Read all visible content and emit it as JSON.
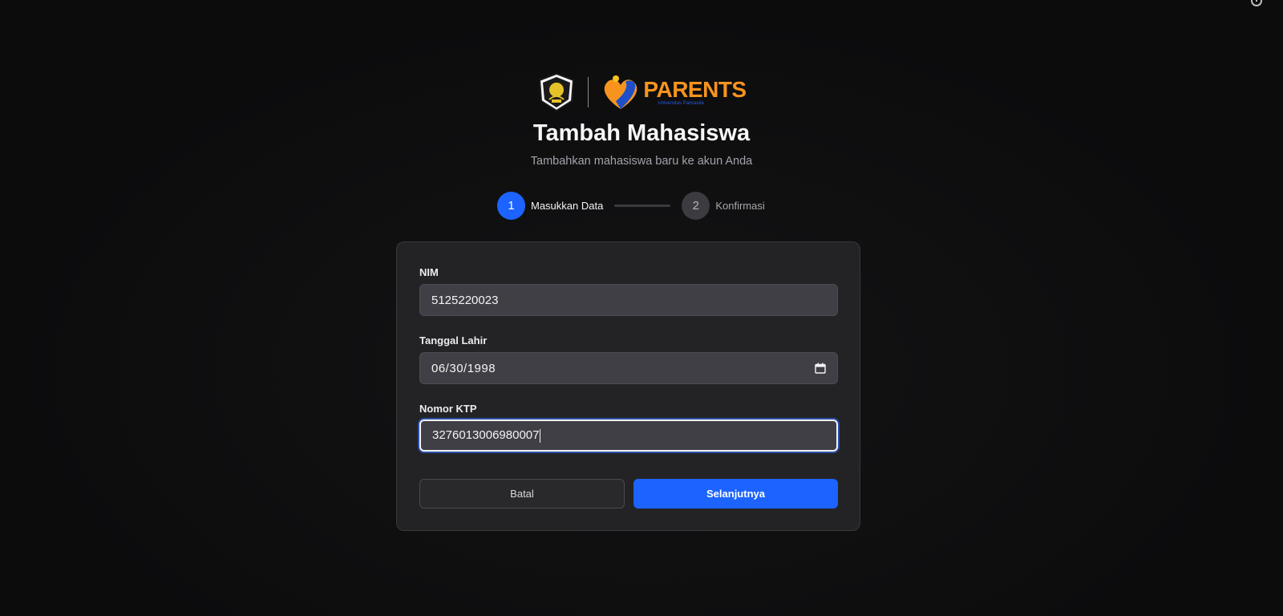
{
  "header": {
    "title": "Tambah Mahasiswa",
    "subtitle": "Tambahkan mahasiswa baru ke akun Anda",
    "logo_text": "PARENTS",
    "logo_subtext": "Universitas Pancasila"
  },
  "stepper": {
    "steps": [
      {
        "number": "1",
        "label": "Masukkan Data",
        "state": "active"
      },
      {
        "number": "2",
        "label": "Konfirmasi",
        "state": "inactive"
      }
    ]
  },
  "form": {
    "nim": {
      "label": "NIM",
      "value": "5125220023"
    },
    "birthdate": {
      "label": "Tanggal Lahir",
      "value": "06/30/1998"
    },
    "ktp": {
      "label": "Nomor KTP",
      "value": "3276013006980007"
    }
  },
  "actions": {
    "cancel_label": "Batal",
    "next_label": "Selanjutnya"
  },
  "colors": {
    "accent": "#1c63ff",
    "background": "#0c0c0d",
    "card": "#232325",
    "logo_orange": "#f7941d",
    "logo_blue": "#2a5bd7"
  },
  "icons": {
    "seal": "university-seal-icon",
    "parents_mark": "parents-heart-logo-icon",
    "calendar": "calendar-icon"
  }
}
